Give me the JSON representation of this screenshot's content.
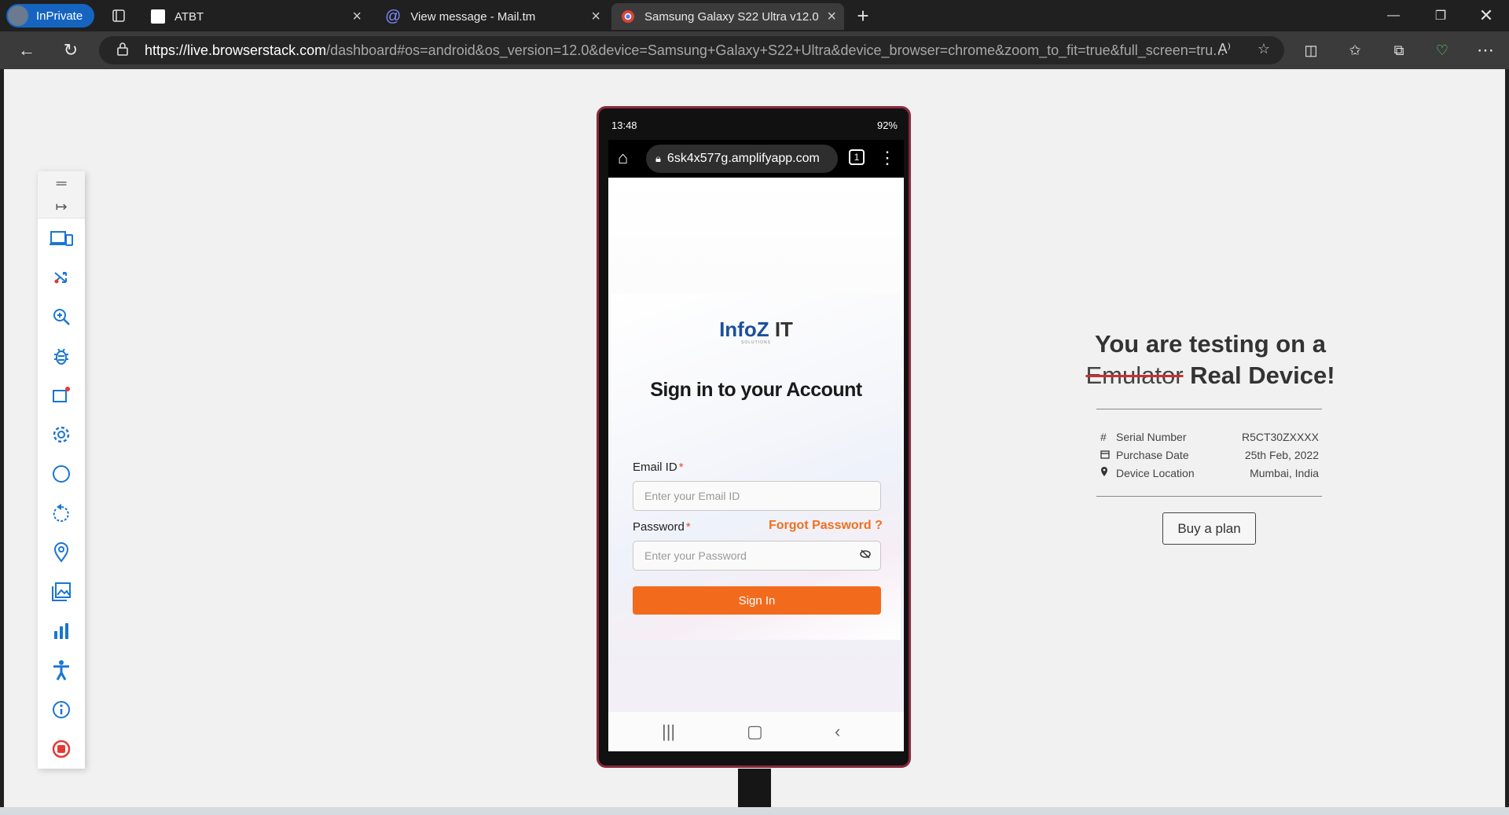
{
  "browser": {
    "profile_label": "InPrivate",
    "tabs": [
      {
        "title": "ATBT",
        "active": false
      },
      {
        "title": "View message - Mail.tm",
        "active": false
      },
      {
        "title": "Samsung Galaxy S22 Ultra v12.0",
        "active": true
      }
    ],
    "new_tab_symbol": "+",
    "url_host": "https://live.browserstack.com",
    "url_rest": "/dashboard#os=android&os_version=12.0&device=Samsung+Galaxy+S22+Ultra&device_browser=chrome&zoom_to_fit=true&full_screen=tru..."
  },
  "toolbar": {
    "items": [
      "menu-icon",
      "expand-icon",
      "switch-device-icon",
      "shuffle-icon",
      "zoom-icon",
      "bug-icon",
      "notification-icon",
      "settings-icon",
      "circle-icon",
      "rotate-icon",
      "location-icon",
      "gallery-icon",
      "stats-icon",
      "accessibility-icon",
      "info-icon",
      "stop-icon"
    ],
    "accent_color": "#1976d2",
    "stop_color": "#e53935"
  },
  "phone": {
    "time": "13:48",
    "battery": "92%",
    "url": "6sk4x577g.amplifyapp.com",
    "tab_count": "1",
    "logo_main": "InfoZ",
    "logo_it": "IT",
    "logo_sub": "SOLUTIONS",
    "heading": "Sign in to your Account",
    "email_label": "Email ID",
    "email_placeholder": "Enter your Email ID",
    "password_label": "Password",
    "forgot_link": "Forgot Password ?",
    "password_placeholder": "Enter your Password",
    "signin_label": "Sign In",
    "required_mark": "*",
    "accent_color": "#f26b1d"
  },
  "device_panel": {
    "heading_line1": "You are testing on a",
    "strike_word": "Emulator",
    "heading_rest": "Real Device!",
    "rows": [
      {
        "icon": "#",
        "key": "Serial Number",
        "value": "R5CT30ZXXXX"
      },
      {
        "icon": "calendar-icon",
        "key": "Purchase Date",
        "value": "25th Feb, 2022"
      },
      {
        "icon": "location-pin-icon",
        "key": "Device Location",
        "value": "Mumbai, India"
      }
    ],
    "button_label": "Buy a plan"
  }
}
